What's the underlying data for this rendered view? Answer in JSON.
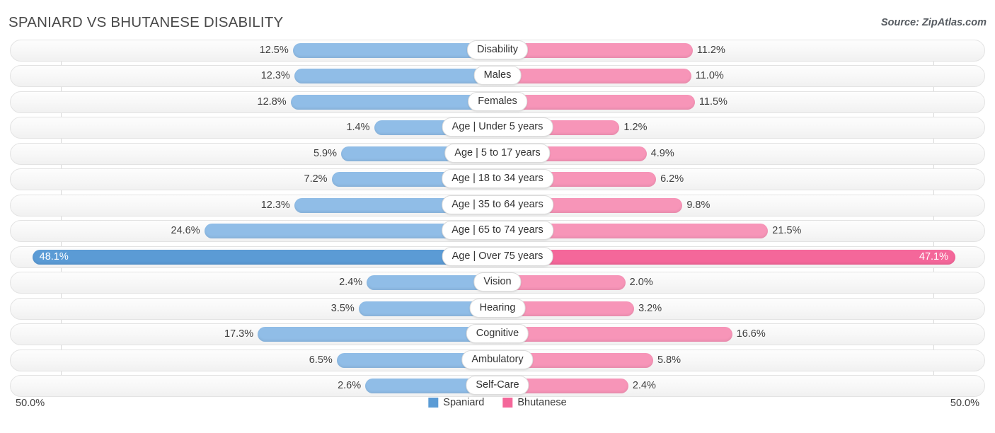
{
  "header": {
    "title": "SPANIARD VS BHUTANESE DISABILITY",
    "source": "Source: ZipAtlas.com"
  },
  "axis": {
    "left_label": "50.0%",
    "right_label": "50.0%"
  },
  "legend": {
    "items": [
      {
        "label": "Spaniard",
        "color": "#5b9bd5"
      },
      {
        "label": "Bhutanese",
        "color": "#f4679a"
      }
    ]
  },
  "colors": {
    "left_bar": "#90bde7",
    "right_bar": "#f795b8",
    "left_bar_highlight": "#5b9bd5",
    "right_bar_highlight": "#f4679a",
    "track": "#f7f7f7",
    "track_border": "#e3e3e3"
  },
  "chart_data": {
    "type": "bar",
    "title": "SPANIARD VS BHUTANESE DISABILITY",
    "subtitle": "Source: ZipAtlas.com",
    "orientation": "horizontal-diverging",
    "xlabel": "",
    "ylabel": "",
    "xlim": [
      50.0,
      50.0
    ],
    "grid": true,
    "legend_position": "bottom-center",
    "categories": [
      "Disability",
      "Males",
      "Females",
      "Age | Under 5 years",
      "Age | 5 to 17 years",
      "Age | 18 to 34 years",
      "Age | 35 to 64 years",
      "Age | 65 to 74 years",
      "Age | Over 75 years",
      "Vision",
      "Hearing",
      "Cognitive",
      "Ambulatory",
      "Self-Care"
    ],
    "series": [
      {
        "name": "Spaniard",
        "values": [
          12.5,
          12.3,
          12.8,
          1.4,
          5.9,
          7.2,
          12.3,
          24.6,
          48.1,
          2.4,
          3.5,
          17.3,
          6.5,
          2.6
        ]
      },
      {
        "name": "Bhutanese",
        "values": [
          11.2,
          11.0,
          11.5,
          1.2,
          4.9,
          6.2,
          9.8,
          21.5,
          47.1,
          2.0,
          3.2,
          16.6,
          5.8,
          2.4
        ]
      }
    ],
    "rows": [
      {
        "label": "Disability",
        "left_value": 12.5,
        "left_text": "12.5%",
        "right_value": 11.2,
        "right_text": "11.2%",
        "highlight": false
      },
      {
        "label": "Males",
        "left_value": 12.3,
        "left_text": "12.3%",
        "right_value": 11.0,
        "right_text": "11.0%",
        "highlight": false
      },
      {
        "label": "Females",
        "left_value": 12.8,
        "left_text": "12.8%",
        "right_value": 11.5,
        "right_text": "11.5%",
        "highlight": false
      },
      {
        "label": "Age | Under 5 years",
        "left_value": 1.4,
        "left_text": "1.4%",
        "right_value": 1.2,
        "right_text": "1.2%",
        "highlight": false
      },
      {
        "label": "Age | 5 to 17 years",
        "left_value": 5.9,
        "left_text": "5.9%",
        "right_value": 4.9,
        "right_text": "4.9%",
        "highlight": false
      },
      {
        "label": "Age | 18 to 34 years",
        "left_value": 7.2,
        "left_text": "7.2%",
        "right_value": 6.2,
        "right_text": "6.2%",
        "highlight": false
      },
      {
        "label": "Age | 35 to 64 years",
        "left_value": 12.3,
        "left_text": "12.3%",
        "right_value": 9.8,
        "right_text": "9.8%",
        "highlight": false
      },
      {
        "label": "Age | 65 to 74 years",
        "left_value": 24.6,
        "left_text": "24.6%",
        "right_value": 21.5,
        "right_text": "21.5%",
        "highlight": false
      },
      {
        "label": "Age | Over 75 years",
        "left_value": 48.1,
        "left_text": "48.1%",
        "right_value": 47.1,
        "right_text": "47.1%",
        "highlight": true
      },
      {
        "label": "Vision",
        "left_value": 2.4,
        "left_text": "2.4%",
        "right_value": 2.0,
        "right_text": "2.0%",
        "highlight": false
      },
      {
        "label": "Hearing",
        "left_value": 3.5,
        "left_text": "3.5%",
        "right_value": 3.2,
        "right_text": "3.2%",
        "highlight": false
      },
      {
        "label": "Cognitive",
        "left_value": 17.3,
        "left_text": "17.3%",
        "right_value": 16.6,
        "right_text": "16.6%",
        "highlight": false
      },
      {
        "label": "Ambulatory",
        "left_value": 6.5,
        "left_text": "6.5%",
        "right_value": 5.8,
        "right_text": "5.8%",
        "highlight": false
      },
      {
        "label": "Self-Care",
        "left_value": 2.6,
        "left_text": "2.6%",
        "right_value": 2.4,
        "right_text": "2.4%",
        "highlight": false
      }
    ]
  }
}
